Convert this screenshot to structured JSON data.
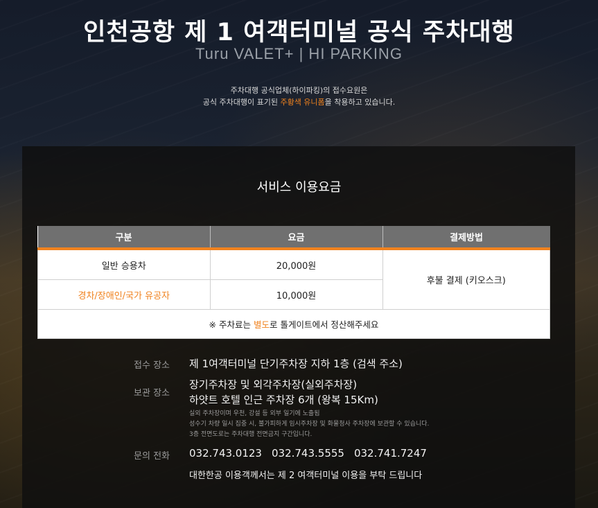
{
  "header": {
    "title": "인천공항 제 1 여객터미널 공식 주차대행",
    "subtitle": "Turu VALET+ | HI PARKING",
    "notice_line1": "주차대행 공식업체(하이파킹)의 접수요원은",
    "notice_line2_pre": "공식 주차대행이 표기된 ",
    "notice_line2_hl": "주황색 유니폼",
    "notice_line2_post": "을 착용하고 있습니다."
  },
  "pricing": {
    "title": "서비스 이용요금",
    "columns": [
      "구분",
      "요금",
      "결제방법"
    ],
    "rows": [
      {
        "category": "일반 승용차",
        "fee": "20,000원"
      },
      {
        "category": "경차/장애인/국가 유공자",
        "fee": "10,000원"
      }
    ],
    "payment": "후불 결제 (키오스크)",
    "note_pre": "※ 주차료는 ",
    "note_hl": "별도",
    "note_post": "로 톨게이트에서 정산해주세요"
  },
  "info": {
    "reception_label": "접수 장소",
    "reception_value": "제 1여객터미널 단기주차장 지하 1층 (검색 주소)",
    "storage_label": "보관 장소",
    "storage_line1": "장기주차장 및 외각주차장(실외주차장)",
    "storage_line2": "하얏트 호텔 인근 주차장 6개 (왕복 15Km)",
    "storage_note1": "실외 주차장이며 우천, 강설 등 외부 일기에 노출됨",
    "storage_note2": "성수기 차량 일시 집중 시, 불가피하게 임시주차장 및 화물청사 주차장에 보관할 수 있습니다.",
    "storage_note3": "3층 전면도로는 주차대행 전면금지 구간입니다.",
    "contact_label": "문의 전화",
    "phones": [
      "032.743.0123",
      "032.743.5555",
      "032.741.7247"
    ],
    "korean_air_note": "대한한공 이용객께서는 제 2 여객터미널 이용을 부탁 드립니다"
  },
  "colors": {
    "accent": "#f0821e",
    "header_gray": "#707070"
  }
}
